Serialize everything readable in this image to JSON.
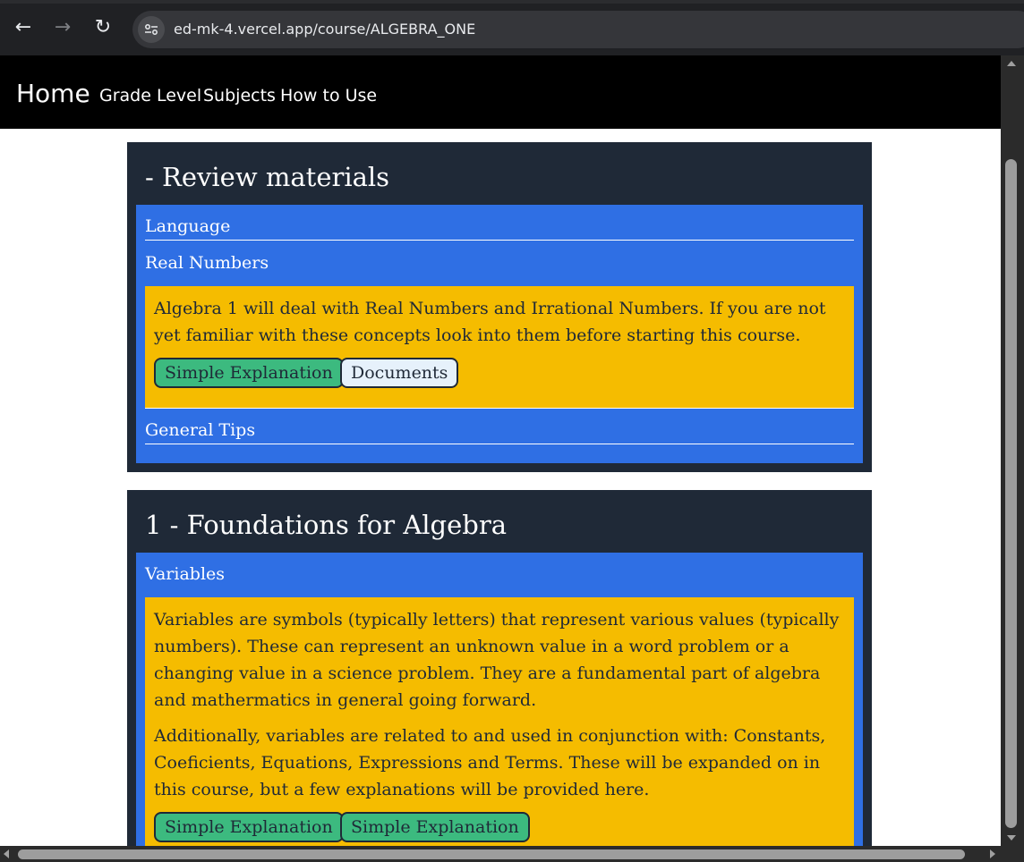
{
  "browser": {
    "url": "ed-mk-4.vercel.app/course/ALGEBRA_ONE",
    "back_icon": "←",
    "forward_icon": "→",
    "reload_icon": "↻"
  },
  "nav": {
    "home": "Home",
    "links": [
      "Grade Level",
      "Subjects",
      "How to Use"
    ]
  },
  "units": [
    {
      "title": "- Review materials",
      "topics": [
        {
          "label": "Language"
        },
        {
          "label": "Real Numbers",
          "paragraphs": [
            "Algebra 1 will deal with Real Numbers and Irrational Numbers. If you are not yet familiar with these concepts look into them before starting this course."
          ],
          "buttons": [
            "Simple Explanation",
            "Documents"
          ]
        },
        {
          "label": "General Tips"
        }
      ]
    },
    {
      "title": "1 - Foundations for Algebra",
      "topics": [
        {
          "label": "Variables",
          "paragraphs": [
            "Variables are symbols (typically letters) that represent various values (typically numbers). These can represent an unknown value in a word problem or a changing value in a science problem. They are a fundamental part of algebra and mathermatics in general going forward.",
            "Additionally, variables are related to and used in conjunction with: Constants, Coeficients, Equations, Expressions and Terms. These will be expanded on in this course, but a few explanations will be provided here."
          ],
          "buttons": [
            "Simple Explanation",
            "Simple Explanation"
          ]
        }
      ]
    }
  ],
  "colors": {
    "nav_bg": "#000000",
    "unit_bg": "#1f2937",
    "topic_panel": "#2f6fe4",
    "content_box": "#f5bc00",
    "button_green": "#3cba7f",
    "button_light": "#e6f1fb"
  }
}
